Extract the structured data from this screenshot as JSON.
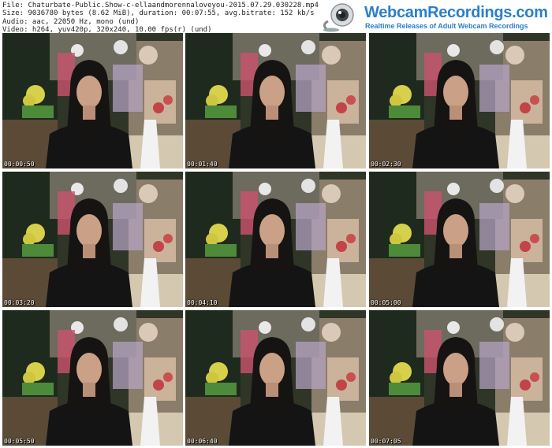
{
  "file_info": {
    "lines": [
      "File: Chaturbate-Public.Show-c-ellaandmorennaloveyou-2015.07.29.030228.mp4",
      "Size: 9036780 bytes (8.62 MiB), duration: 00:07:55, avg.bitrate: 152 kb/s",
      "Audio: aac, 22050 Hz, mono (und)",
      "Video: h264, yuv420p, 320x240, 10.00 fps(r) (und)"
    ]
  },
  "logo": {
    "brand": "WebcamRecordings.com",
    "tagline": "Realtime Releases of Adult Webcam Recordings"
  },
  "thumbnails": [
    {
      "timestamp": "00:00:50"
    },
    {
      "timestamp": "00:01:40"
    },
    {
      "timestamp": "00:02:30"
    },
    {
      "timestamp": "00:03:20"
    },
    {
      "timestamp": "00:04:10"
    },
    {
      "timestamp": "00:05:00"
    },
    {
      "timestamp": "00:05:50"
    },
    {
      "timestamp": "00:06:40"
    },
    {
      "timestamp": "00:07:05"
    }
  ]
}
